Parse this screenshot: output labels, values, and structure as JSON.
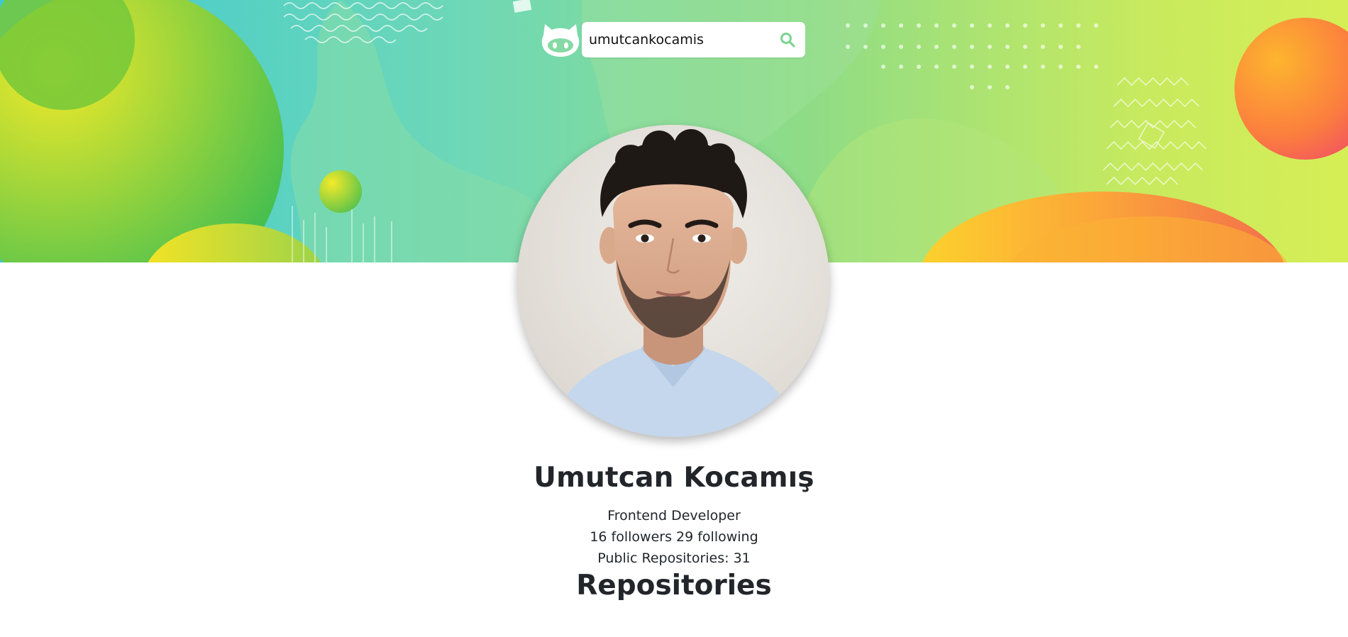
{
  "header": {
    "logo_icon": "octocat-icon",
    "search": {
      "value": "umutcankocamis",
      "placeholder": "",
      "button_icon": "search-icon",
      "accent_color": "#7bd491"
    }
  },
  "banner": {
    "colors": [
      "#4fd0cf",
      "#7ed67c",
      "#c6e85a",
      "#f6d31f",
      "#fc8c3c",
      "#f25a6e"
    ]
  },
  "profile": {
    "avatar": "profile-photo",
    "name": "Umutcan Kocamış",
    "bio": "Frontend Developer",
    "stats": "16 followers 29 following",
    "public_repos": "Public Repositories: 31"
  },
  "repositories": {
    "heading": "Repositories"
  }
}
